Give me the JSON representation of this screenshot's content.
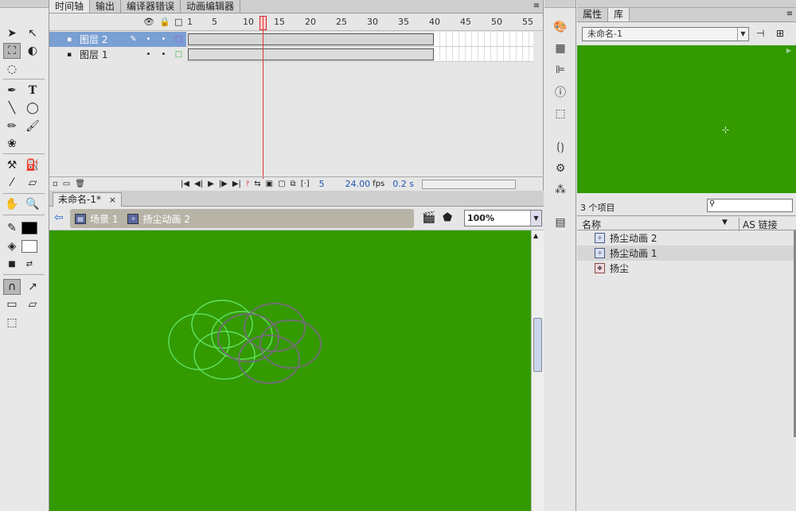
{
  "timeline": {
    "tabs": [
      "时间轴",
      "输出",
      "编译器错误",
      "动画编辑器"
    ],
    "frame_numbers": [
      "1",
      "5",
      "10",
      "15",
      "20",
      "25",
      "30",
      "35",
      "40",
      "45",
      "50",
      "55"
    ],
    "layers": [
      {
        "name": "图层 2"
      },
      {
        "name": "图层 1"
      }
    ],
    "current_frame": "5",
    "fps": "24.00",
    "fps_unit": "fps",
    "time": "0.2 s"
  },
  "document": {
    "tab": "未命名-1*",
    "close": "×",
    "breadcrumb": [
      "场景 1",
      "扬尘动画 2"
    ],
    "zoom": "100%"
  },
  "panel": {
    "tabs": [
      "属性",
      "库"
    ],
    "library_doc": "未命名-1",
    "item_count": "3 个项目",
    "columns": {
      "name": "名称",
      "linkage": "AS 链接"
    },
    "items": [
      {
        "name": "扬尘动画 2"
      },
      {
        "name": "扬尘动画 1"
      },
      {
        "name": "扬尘"
      }
    ]
  }
}
